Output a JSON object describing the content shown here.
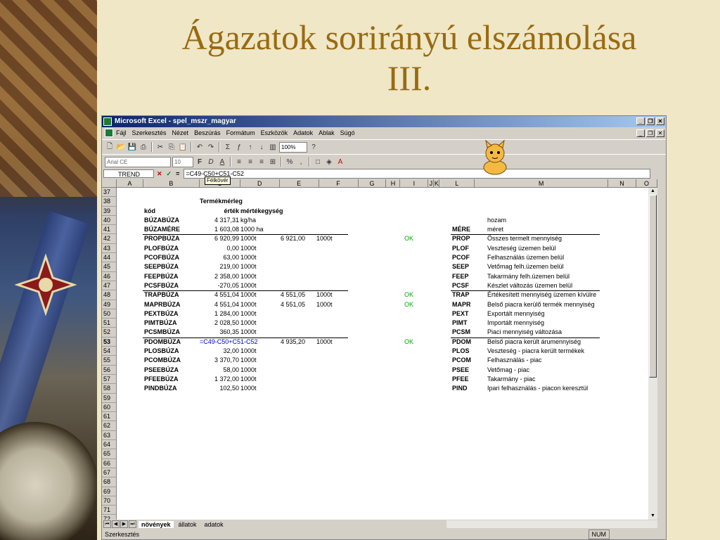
{
  "slide": {
    "title_line1": "Ágazatok sorirányú elszámolása",
    "title_line2": "III."
  },
  "window": {
    "title": "Microsoft Excel - spel_mszr_magyar"
  },
  "menu": [
    "Fájl",
    "Szerkesztés",
    "Nézet",
    "Beszúrás",
    "Formátum",
    "Eszközök",
    "Adatok",
    "Ablak",
    "Súgó"
  ],
  "toolbar": {
    "zoom": "100%",
    "font": "Arial CE",
    "size": "10"
  },
  "formula_bar": {
    "name": "TREND",
    "formula": "=C49-C50+C51-C52",
    "tooltip": "Félkövér"
  },
  "columns": [
    "A",
    "B",
    "C",
    "D",
    "E",
    "F",
    "G",
    "H",
    "I",
    "J",
    "K",
    "L",
    "M",
    "N",
    "O"
  ],
  "rows": [
    {
      "n": "37"
    },
    {
      "n": "38",
      "c": "Termékmérleg",
      "c_bold": true
    },
    {
      "n": "39",
      "b": "kód",
      "c": "érték",
      "d": "mértékegység",
      "hdr": true
    },
    {
      "n": "40",
      "b": "BÚZABÚZA",
      "c": "4 317,31",
      "d": "kg/ha",
      "m": "hozam"
    },
    {
      "n": "41",
      "b": "BÚZAMÉRE",
      "c": "1 603,08",
      "d": "1000 ha",
      "l": "MÉRE",
      "m": "méret"
    },
    {
      "n": "42",
      "b": "PROPBÚZA",
      "c": "6 920,99",
      "d": "1000t",
      "e": "6 921,00",
      "f": "1000t",
      "h": "OK",
      "l": "PROP",
      "m": "Összes termelt mennyiség",
      "line": true
    },
    {
      "n": "43",
      "b": "PLOFBÚZA",
      "c": "0,00",
      "d": "1000t",
      "l": "PLOF",
      "m": "Veszteség üzemen belül"
    },
    {
      "n": "44",
      "b": "PCOFBÚZA",
      "c": "63,00",
      "d": "1000t",
      "l": "PCOF",
      "m": "Felhasználás üzemen belül"
    },
    {
      "n": "45",
      "b": "SEEPBÚZA",
      "c": "219,00",
      "d": "1000t",
      "l": "SEEP",
      "m": "Vetőmag felh.üzemen belül"
    },
    {
      "n": "46",
      "b": "FEEPBÚZA",
      "c": "2 358,00",
      "d": "1000t",
      "l": "FEEP",
      "m": "Takarmány felh.üzemen belül"
    },
    {
      "n": "47",
      "b": "PCSFBÚZA",
      "c": "-270,05",
      "d": "1000t",
      "l": "PCSF",
      "m": "Készlet változás üzemen belül"
    },
    {
      "n": "48",
      "b": "TRAPBÚZA",
      "c": "4 551,04",
      "d": "1000t",
      "e": "4 551,05",
      "f": "1000t",
      "h": "OK",
      "l": "TRAP",
      "m": "Értékesített mennyiség üzemen kívülre",
      "line": true
    },
    {
      "n": "49",
      "b": "MAPRBÚZA",
      "c": "4 551,04",
      "d": "1000t",
      "e": "4 551,05",
      "f": "1000t",
      "h": "OK",
      "l": "MAPR",
      "m": "Belső piacra kerülő termék mennyiség"
    },
    {
      "n": "50",
      "b": "PEXTBÚZA",
      "c": "1 284,00",
      "d": "1000t",
      "l": "PEXT",
      "m": "Exportált mennyiség"
    },
    {
      "n": "51",
      "b": "PIMTBÚZA",
      "c": "2 028,50",
      "d": "1000t",
      "l": "PIMT",
      "m": "Importált mennyiség"
    },
    {
      "n": "52",
      "b": "PCSMBÚZA",
      "c": "360,35",
      "d": "1000t",
      "l": "PCSM",
      "m": "Piaci mennyiség változása"
    },
    {
      "n": "53",
      "b": "PDOMBÚZA",
      "c": "=C49-C50+C51-C52",
      "e": "4 935,20",
      "f": "1000t",
      "h": "OK",
      "l": "PDOM",
      "m": "Belső piacra került árumennyiség",
      "line": true,
      "active": true
    },
    {
      "n": "54",
      "b": "PLOSBÚZA",
      "c": "32,00",
      "d": "1000t",
      "l": "PLOS",
      "m": "Veszteség - piacra került termékek"
    },
    {
      "n": "55",
      "b": "PCOMBÚZA",
      "c": "3 370,70",
      "d": "1000t",
      "l": "PCOM",
      "m": "Felhasználás - piac"
    },
    {
      "n": "56",
      "b": "PSEEBÚZA",
      "c": "58,00",
      "d": "1000t",
      "l": "PSEE",
      "m": "Vetőmag - piac"
    },
    {
      "n": "57",
      "b": "PFEEBÚZA",
      "c": "1 372,00",
      "d": "1000t",
      "l": "PFEE",
      "m": "Takarmány - piac"
    },
    {
      "n": "58",
      "b": "PINDBÚZA",
      "c": "102,50",
      "d": "1000t",
      "l": "PIND",
      "m": "Ipari felhasználás - piacon keresztül"
    },
    {
      "n": "59"
    },
    {
      "n": "60"
    },
    {
      "n": "61"
    },
    {
      "n": "62"
    },
    {
      "n": "63"
    },
    {
      "n": "64"
    },
    {
      "n": "65"
    },
    {
      "n": "66"
    },
    {
      "n": "67"
    },
    {
      "n": "68"
    },
    {
      "n": "69"
    },
    {
      "n": "70"
    },
    {
      "n": "71"
    },
    {
      "n": "72"
    }
  ],
  "tabs": [
    "növények",
    "állatok",
    "adatok"
  ],
  "status": {
    "left": "Szerkesztés",
    "num": "NUM"
  }
}
